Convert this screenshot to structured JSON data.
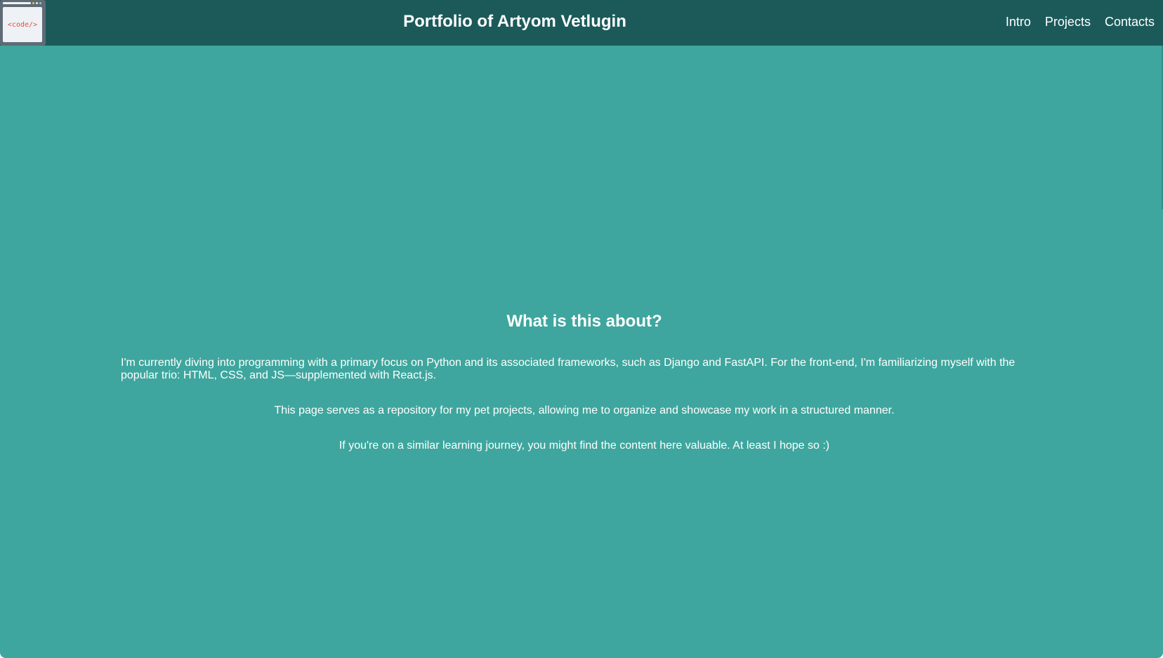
{
  "header": {
    "logo_text": "<code/>",
    "title": "Portfolio of Artyom Vetlugin",
    "nav": [
      {
        "label": "Intro"
      },
      {
        "label": "Projects"
      },
      {
        "label": "Contacts"
      }
    ]
  },
  "main": {
    "heading": "What is this about?",
    "paragraphs": [
      "I'm currently diving into programming with a primary focus on Python and its associated frameworks, such as Django and FastAPI. For the front-end, I'm familiarizing myself with the popular trio: HTML, CSS, and JS—supplemented with React.js.",
      "This page serves as a repository for my pet projects, allowing me to organize and showcase my work in a structured manner.",
      "If you're on a similar learning journey, you might find the content here valuable. At least I hope so :)"
    ]
  },
  "colors": {
    "header_bg": "#1c5a5a",
    "page_bg": "#3ea69e",
    "text": "#ffffff",
    "logo_code": "#e0513f"
  },
  "icons": {
    "logo": "code-window-icon"
  }
}
